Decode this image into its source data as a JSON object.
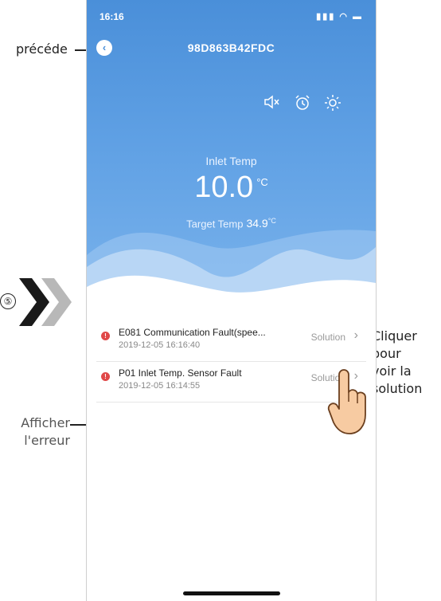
{
  "annotations": {
    "back_label": "précéde",
    "step_number": "⑤",
    "show_error_line1": "Afficher",
    "show_error_line2": "l'erreur",
    "click_line1": "Cliquer",
    "click_line2": "pour",
    "click_line3": "voir la",
    "click_line4": "solution"
  },
  "status_bar": {
    "time": "16:16",
    "icons": "signal wifi battery"
  },
  "header": {
    "device_id": "98D863B42FDC"
  },
  "controls": [
    "mute-icon",
    "alarm-clock-icon",
    "sun-icon"
  ],
  "inlet": {
    "label": "Inlet Temp",
    "value": "10.0",
    "unit": "°C"
  },
  "target": {
    "label": "Target Temp",
    "value": "34.9",
    "unit": "°C"
  },
  "faults": [
    {
      "code_name": "E081 Communication Fault(spee...",
      "time": "2019-12-05 16:16:40",
      "action": "Solution"
    },
    {
      "code_name": "P01 Inlet Temp. Sensor Fault",
      "time": "2019-12-05 16:14:55",
      "action": "Solution"
    }
  ],
  "colors": {
    "hero_top": "#4a8fd9",
    "hero_bottom": "#7ab3ec",
    "fault_dot": "#e04848"
  }
}
